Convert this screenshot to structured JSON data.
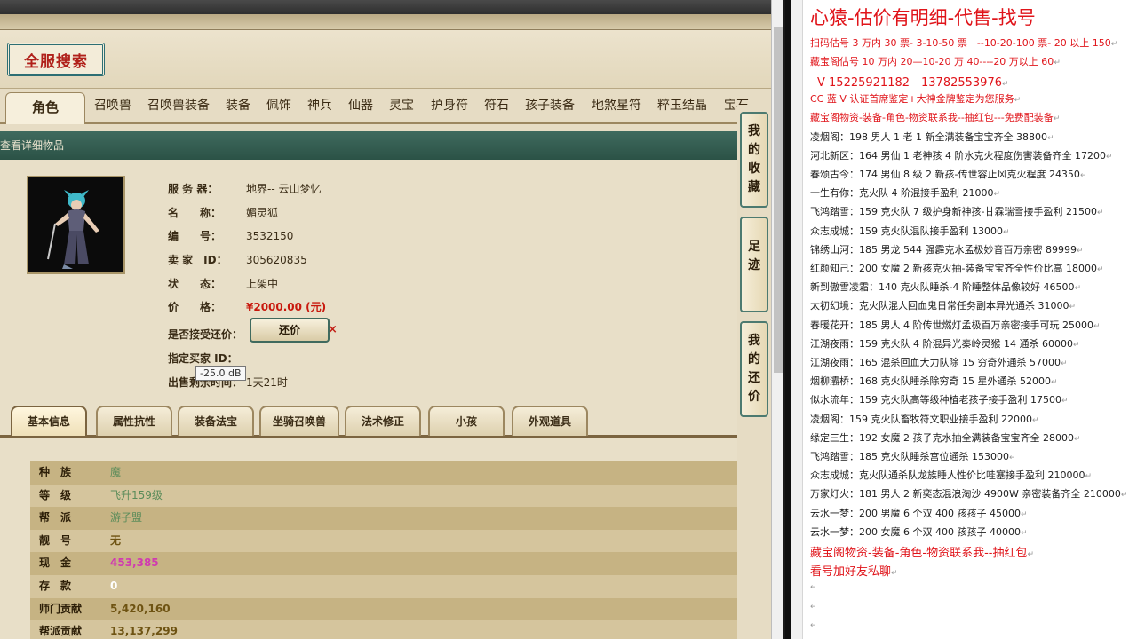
{
  "search_logo": "全服搜索",
  "tabs": [
    "角色",
    "召唤兽",
    "召唤兽装备",
    "装备",
    "佩饰",
    "神兵",
    "仙器",
    "灵宝",
    "护身符",
    "符石",
    "孩子装备",
    "地煞星符",
    "粹玉结晶",
    "宝石"
  ],
  "subbar_label": "查看详细物品",
  "details": {
    "server_label": "服 务 器：",
    "server_value": "地界-- 云山梦忆",
    "name_label": "名　　称：",
    "name_value": "媚灵狐",
    "id_label": "编　　号：",
    "id_value": "3532150",
    "seller_label": "卖 家　ID：",
    "seller_value": "305620835",
    "status_label": "状　　态：",
    "status_value": "上架中",
    "price_label": "价　　格：",
    "price_value": "¥2000.00 (元)",
    "counter_label": "是否接受还价：",
    "counter_button": "还价",
    "counter_close": "×",
    "buyer_label": "指定买家 ID：",
    "sell_time_label": "出售剩余时间：",
    "sell_time_value": "1天21时"
  },
  "tooltip": "-25.0 dB",
  "subtabs": [
    "基本信息",
    "属性抗性",
    "装备法宝",
    "坐骑召唤兽",
    "法术修正",
    "小孩",
    "外观道具"
  ],
  "attributes": [
    {
      "k": "种　族",
      "v": "魔"
    },
    {
      "k": "等　级",
      "v": "飞升159级"
    },
    {
      "k": "帮　派",
      "v": "游子盟"
    },
    {
      "k": "靓　号",
      "v": "无"
    },
    {
      "k": "现　金",
      "v": "453,385"
    },
    {
      "k": "存　款",
      "v": "0"
    },
    {
      "k": "师门贡献",
      "v": "5,420,160"
    },
    {
      "k": "帮派贡献",
      "v": "13,137,299"
    }
  ],
  "side_tabs": [
    "我的收藏",
    "足迹",
    "我的还价"
  ],
  "note": {
    "title": "心猿-估价有明细-代售-找号",
    "lines": [
      "扫码估号 3 万内 30 票- 3-10-50 票　--10-20-100 票- 20 以上 150",
      "藏宝阁估号 10 万内 20—10-20 万 40----20 万以上 60",
      "V 15225921182　13782553976",
      "CC 蓝 V 认证首席鉴定+大神金牌鉴定为您服务",
      "藏宝阁物资-装备-角色-物资联系我--抽红包---免费配装备",
      "凌烟阁：198 男人 1 老 1 新全满装备宝宝齐全 38800",
      "河北新区：164 男仙 1 老神孩 4 阶水克火程度伤害装备齐全 17200",
      "春颂古今：174 男仙 8 级 2 新孩-传世容止风克火程度 24350",
      "一生有你：克火队 4 阶混接手盈利 21000",
      "飞鸿踏雪：159 克火队 7 级护身新神孩-甘霖瑞雪接手盈利 21500",
      "众志成城：159 克火队混队接手盈利 13000",
      "锦绣山河：185 男龙 544 强霹克水孟极妙音百万亲密 89999",
      "红颜知己：200 女魔 2 新孩克火抽-装备宝宝齐全性价比高 18000",
      "新到傲雪凌霜：140 克火队睡杀-4 阶睡整体品像较好 46500",
      "太初幻境：克火队混人回血鬼日常任务副本异光通杀 31000",
      "春暖花开：185 男人 4 阶传世燃灯孟极百万亲密接手可玩 25000",
      "江湖夜雨：159 克火队 4 阶混异光秦岭灵猴 14 通杀 60000",
      "江湖夜雨：165 混杀回血大力队除 15 穷奇外通杀 57000",
      "烟柳灞桥：168 克火队睡杀除穷奇 15 星外通杀 52000",
      "似水流年：159 克火队高等级种植老孩子接手盈利 17500",
      "凌烟阁：159 克火队畜牧符文职业接手盈利 22000",
      "缘定三生：192 女魔 2 孩子克水抽全满装备宝宝齐全 28000",
      "飞鸿踏雪：185 克火队睡杀宫位通杀 153000",
      "众志成城：克火队通杀队龙族睡人性价比哇塞接手盈利 210000",
      "万家灯火：181 男人 2 新奕态混浪淘沙 4900W 亲密装备齐全 210000",
      "云水一梦：200 男魔 6 个双 400 孩孩子 45000",
      "云水一梦：200 女魔 6 个双 400 孩孩子 40000",
      "藏宝阁物资-装备-角色-物资联系我--抽红包",
      "看号加好友私聊"
    ],
    "pilcrow": "↵"
  }
}
